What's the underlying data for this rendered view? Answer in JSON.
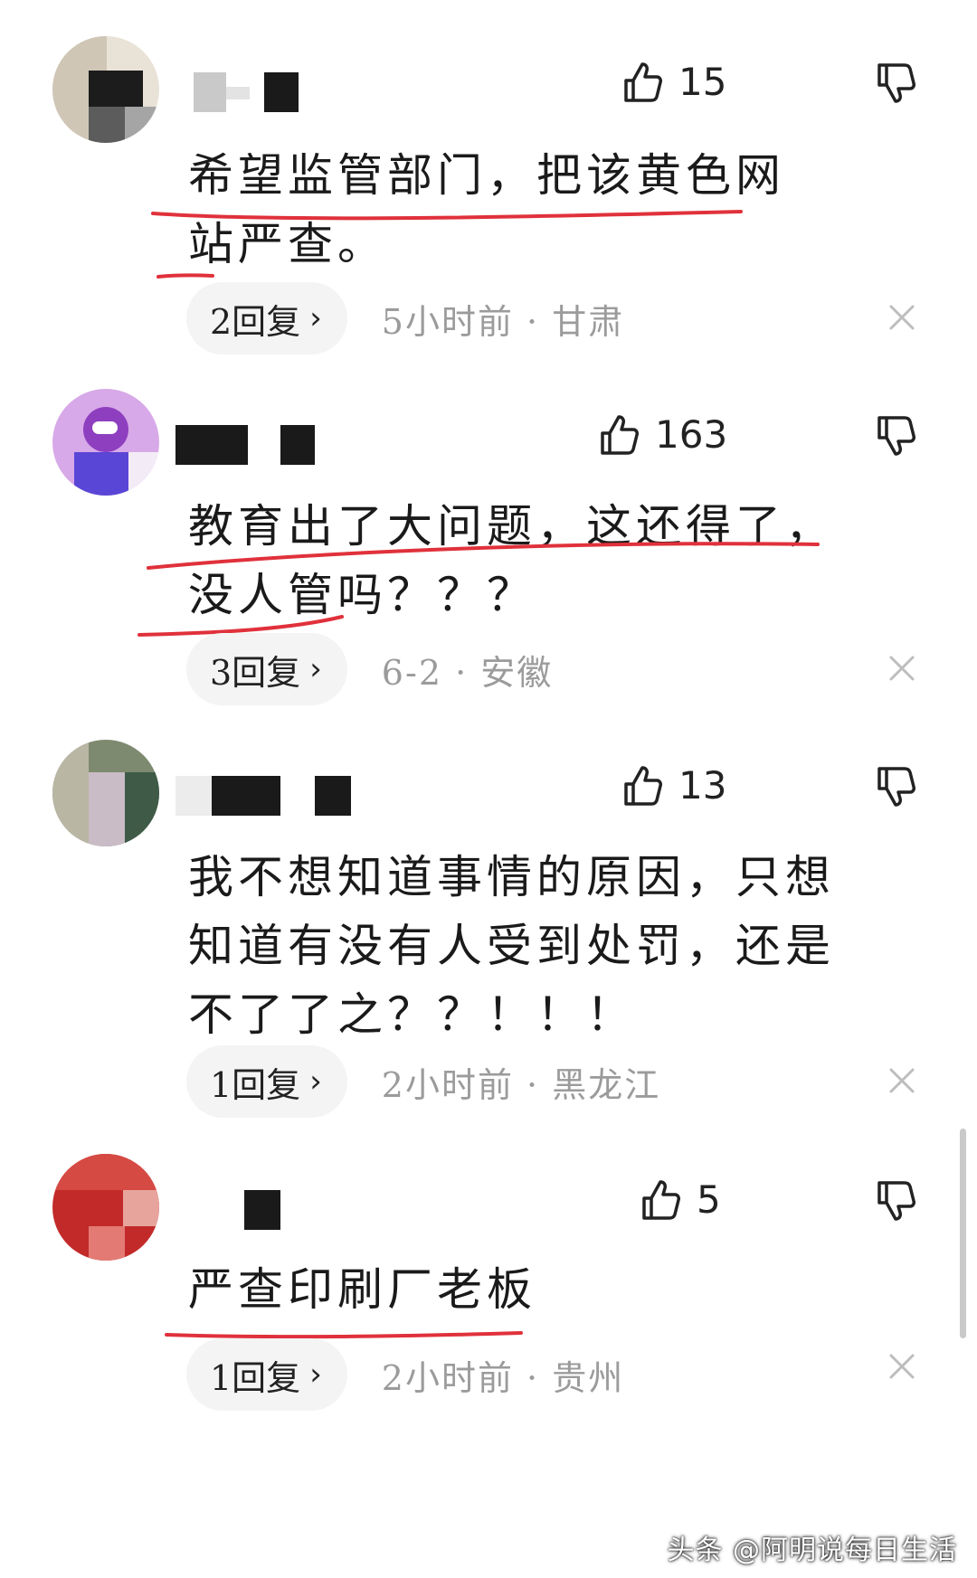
{
  "comments": [
    {
      "likes": "15",
      "text": "希望监管部门，把该黄色网站严查。",
      "reply_label": "2回复",
      "chevron": "›",
      "time_location": "5小时前 · 甘肃"
    },
    {
      "likes": "163",
      "text": "教育出了大问题，这还得了，没人管吗？？？",
      "reply_label": "3回复",
      "chevron": "›",
      "time_location": "6-2 · 安徽"
    },
    {
      "likes": "13",
      "text": "我不想知道事情的原因，只想知道有没有人受到处罚，还是不了了之？？！！！",
      "reply_label": "1回复",
      "chevron": "›",
      "time_location": "2小时前 · 黑龙江"
    },
    {
      "likes": "5",
      "text": "严查印刷厂老板",
      "reply_label": "1回复",
      "chevron": "›",
      "time_location": "2小时前 · 贵州"
    }
  ],
  "icons": {
    "like": "thumb-up-icon",
    "dislike": "thumb-down-icon",
    "close": "close-icon"
  },
  "colors": {
    "underline": "#e0313b",
    "meta_text": "#9b9b9b",
    "reply_bg": "#f4f4f4"
  },
  "watermark": "头条 @阿明说每日生活"
}
